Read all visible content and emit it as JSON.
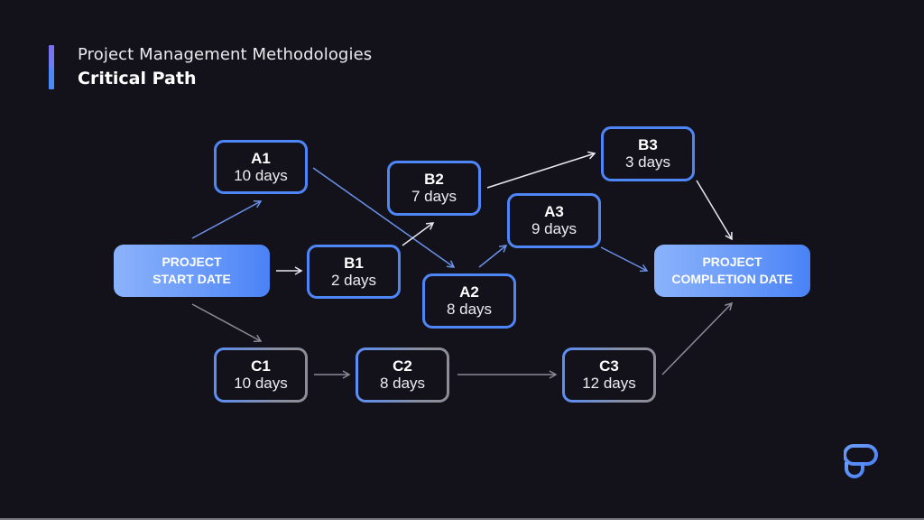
{
  "header": {
    "subtitle": "Project Management Methodologies",
    "title": "Critical Path"
  },
  "colors": {
    "background": "#13121b",
    "accent_blue": "#4f86f7",
    "edge_blue": "#6a90e8",
    "edge_white": "#e8e8ee",
    "edge_gray": "#8a8a98"
  },
  "nodes": {
    "start": {
      "line1": "PROJECT",
      "line2": "START DATE"
    },
    "end": {
      "line1": "PROJECT",
      "line2": "COMPLETION DATE"
    },
    "a1": {
      "id": "A1",
      "duration": "10 days"
    },
    "a2": {
      "id": "A2",
      "duration": "8 days"
    },
    "a3": {
      "id": "A3",
      "duration": "9 days"
    },
    "b1": {
      "id": "B1",
      "duration": "2 days"
    },
    "b2": {
      "id": "B2",
      "duration": "7 days"
    },
    "b3": {
      "id": "B3",
      "duration": "3 days"
    },
    "c1": {
      "id": "C1",
      "duration": "10 days"
    },
    "c2": {
      "id": "C2",
      "duration": "8 days"
    },
    "c3": {
      "id": "C3",
      "duration": "12 days"
    }
  },
  "edges": [
    {
      "from": "start",
      "to": "a1",
      "style": "blue"
    },
    {
      "from": "start",
      "to": "b1",
      "style": "white"
    },
    {
      "from": "start",
      "to": "c1",
      "style": "gray"
    },
    {
      "from": "a1",
      "to": "a2",
      "style": "blue"
    },
    {
      "from": "b1",
      "to": "b2",
      "style": "white"
    },
    {
      "from": "a2",
      "to": "a3",
      "style": "blue"
    },
    {
      "from": "b2",
      "to": "b3",
      "style": "white"
    },
    {
      "from": "a3",
      "to": "end",
      "style": "blue"
    },
    {
      "from": "b3",
      "to": "end",
      "style": "white"
    },
    {
      "from": "c1",
      "to": "c2",
      "style": "gray"
    },
    {
      "from": "c2",
      "to": "c3",
      "style": "gray"
    },
    {
      "from": "c3",
      "to": "end",
      "style": "gray"
    }
  ],
  "logo": {
    "icon": "brand-logo-icon"
  }
}
